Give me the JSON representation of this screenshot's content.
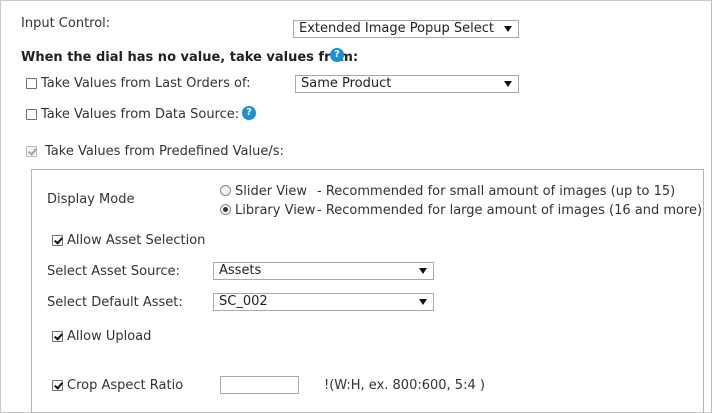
{
  "input_control": {
    "label": "Input Control:",
    "select_value": "Extended Image Popup Selecto"
  },
  "no_value_heading": "When the dial has no value, take values from:",
  "last_orders": {
    "label": "Take Values from Last Orders of:",
    "checked": false,
    "select_value": "Same Product"
  },
  "data_source": {
    "label": "Take Values from Data Source:",
    "checked": false
  },
  "predefined": {
    "label": "Take Values from Predefined Value/s:",
    "checked": true,
    "disabled": true
  },
  "panel": {
    "display_mode_label": "Display Mode",
    "slider_view_label": "Slider View",
    "slider_view_desc": "- Recommended for small amount of images (up to 15)",
    "library_view_label": "Library View",
    "library_view_desc": "- Recommended for large amount of images (16 and more)",
    "selected_mode": "Library View",
    "allow_asset_selection_label": "Allow Asset Selection",
    "select_asset_source_label": "Select Asset Source:",
    "select_asset_source_value": "Assets",
    "select_default_asset_label": "Select Default Asset:",
    "select_default_asset_value": "SC_002",
    "allow_upload_label": "Allow Upload",
    "crop_aspect_ratio_label": "Crop Aspect Ratio",
    "crop_aspect_ratio_value": "",
    "crop_aspect_ratio_hint": "!(W:H, ex. 800:600, 5:4 )"
  },
  "help_glyph": "?",
  "colors": {
    "help_icon": "#1a8fd6",
    "border": "#a9a9a9"
  }
}
